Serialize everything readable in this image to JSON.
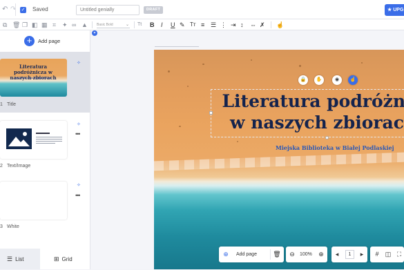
{
  "topbar": {
    "undo_icon": "undo-icon",
    "redo_icon": "redo-icon",
    "saved_label": "Saved",
    "title_value": "Untitled genially",
    "draft_badge": "DRAFT",
    "upgrade_label": "UPG"
  },
  "toolbar": {
    "font_select_value": "Basic Bold",
    "text_size_label": "Tt",
    "bold_label": "B",
    "italic_label": "I",
    "underline_label": "U",
    "caps_label": "Tт"
  },
  "sidebar": {
    "add_page_label": "Add page",
    "pages": [
      {
        "number": "1",
        "label": "Title",
        "thumb_title": "Literatura podróżnicza w naszych zbiorach",
        "thumb_sub": "Miejska Biblioteka Publiczna w Białej Podlaskiej"
      },
      {
        "number": "2",
        "label": "Text/Image"
      },
      {
        "number": "3",
        "label": "White"
      }
    ],
    "tab_list": "List",
    "tab_grid": "Grid"
  },
  "slide": {
    "title_line1": "Literatura podróżni",
    "title_line2": "w naszych zbiorac",
    "subtitle": "Miejska Biblioteka w Białej Podlaskiej"
  },
  "bottom_bar": {
    "add_page_label": "Add page",
    "zoom_value": "100%",
    "page_value": "1"
  },
  "colors": {
    "accent": "#3a6de8",
    "title_navy": "#14234d",
    "subtitle_blue": "#2b58b6"
  }
}
